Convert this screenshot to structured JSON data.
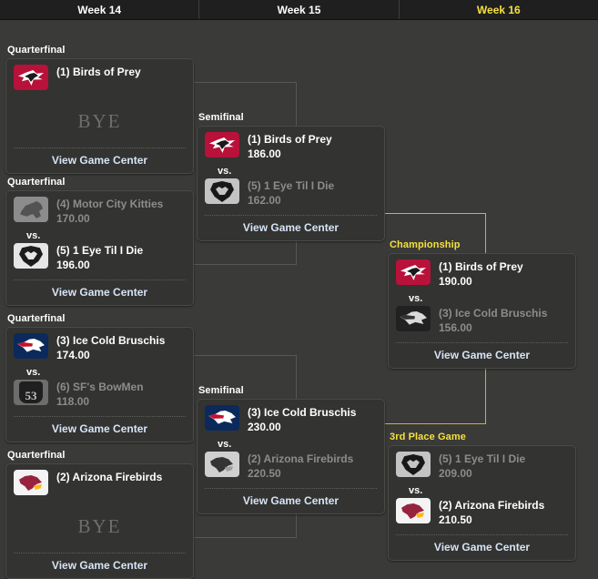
{
  "header": {
    "weeks": [
      {
        "label": "Week 14",
        "active": false
      },
      {
        "label": "Week 15",
        "active": false
      },
      {
        "label": "Week 16",
        "active": true
      }
    ]
  },
  "labels": {
    "vs": "vs.",
    "bye": "BYE",
    "game_center": "View Game Center"
  },
  "rounds": {
    "quarterfinal": "Quarterfinal",
    "semifinal": "Semifinal",
    "championship": "Championship",
    "third_place": "3rd Place Game"
  },
  "colors": {
    "page_background": "#3a3a38",
    "header_background": "#1f1f1f",
    "card_background": "#333331",
    "card_border": "#4a4a47",
    "accent_gold": "#f5e03c",
    "connector_gold": "#c8b43c",
    "connector_gray": "#575754",
    "winner_text": "#ffffff",
    "loser_text": "#8c8c89",
    "link_text": "#d6e4f5",
    "bye_text": "#6d6d6a"
  },
  "matchups": {
    "qf1": {
      "round": "Quarterfinal",
      "bye": true,
      "teams": [
        {
          "name": "(1) Birds of Prey",
          "score": "",
          "logo": "falcons-logo",
          "loser": false
        }
      ],
      "link": "View Game Center"
    },
    "qf2": {
      "round": "Quarterfinal",
      "bye": false,
      "teams": [
        {
          "name": "(4) Motor City Kitties",
          "score": "170.00",
          "logo": "lions-logo",
          "loser": true
        },
        {
          "name": "(5) 1 Eye Til I Die",
          "score": "196.00",
          "logo": "raiders-logo",
          "loser": false
        }
      ],
      "link": "View Game Center"
    },
    "qf3": {
      "round": "Quarterfinal",
      "bye": false,
      "teams": [
        {
          "name": "(3) Ice Cold Bruschis",
          "score": "174.00",
          "logo": "patriots-logo",
          "loser": false
        },
        {
          "name": "(6) SF's BowMen",
          "score": "118.00",
          "logo": "niners-logo",
          "loser": true
        }
      ],
      "link": "View Game Center"
    },
    "qf4": {
      "round": "Quarterfinal",
      "bye": true,
      "teams": [
        {
          "name": "(2) Arizona Firebirds",
          "score": "",
          "logo": "cardinals-logo",
          "loser": false
        }
      ],
      "link": "View Game Center"
    },
    "sf1": {
      "round": "Semifinal",
      "bye": false,
      "teams": [
        {
          "name": "(1) Birds of Prey",
          "score": "186.00",
          "logo": "falcons-logo",
          "loser": false
        },
        {
          "name": "(5) 1 Eye Til I Die",
          "score": "162.00",
          "logo": "raiders-logo",
          "loser": true
        }
      ],
      "link": "View Game Center"
    },
    "sf2": {
      "round": "Semifinal",
      "bye": false,
      "teams": [
        {
          "name": "(3) Ice Cold Bruschis",
          "score": "230.00",
          "logo": "patriots-logo",
          "loser": false
        },
        {
          "name": "(2) Arizona Firebirds",
          "score": "220.50",
          "logo": "cardinals-logo",
          "loser": true
        }
      ],
      "link": "View Game Center"
    },
    "final": {
      "round": "Championship",
      "bye": false,
      "teams": [
        {
          "name": "(1) Birds of Prey",
          "score": "190.00",
          "logo": "falcons-logo",
          "loser": false
        },
        {
          "name": "(3) Ice Cold Bruschis",
          "score": "156.00",
          "logo": "patriots-logo",
          "loser": true
        }
      ],
      "link": "View Game Center"
    },
    "third": {
      "round": "3rd Place Game",
      "bye": false,
      "teams": [
        {
          "name": "(5) 1 Eye Til I Die",
          "score": "209.00",
          "logo": "raiders-logo",
          "loser": true
        },
        {
          "name": "(2) Arizona Firebirds",
          "score": "210.50",
          "logo": "cardinals-logo",
          "loser": false
        }
      ],
      "link": "View Game Center"
    }
  }
}
